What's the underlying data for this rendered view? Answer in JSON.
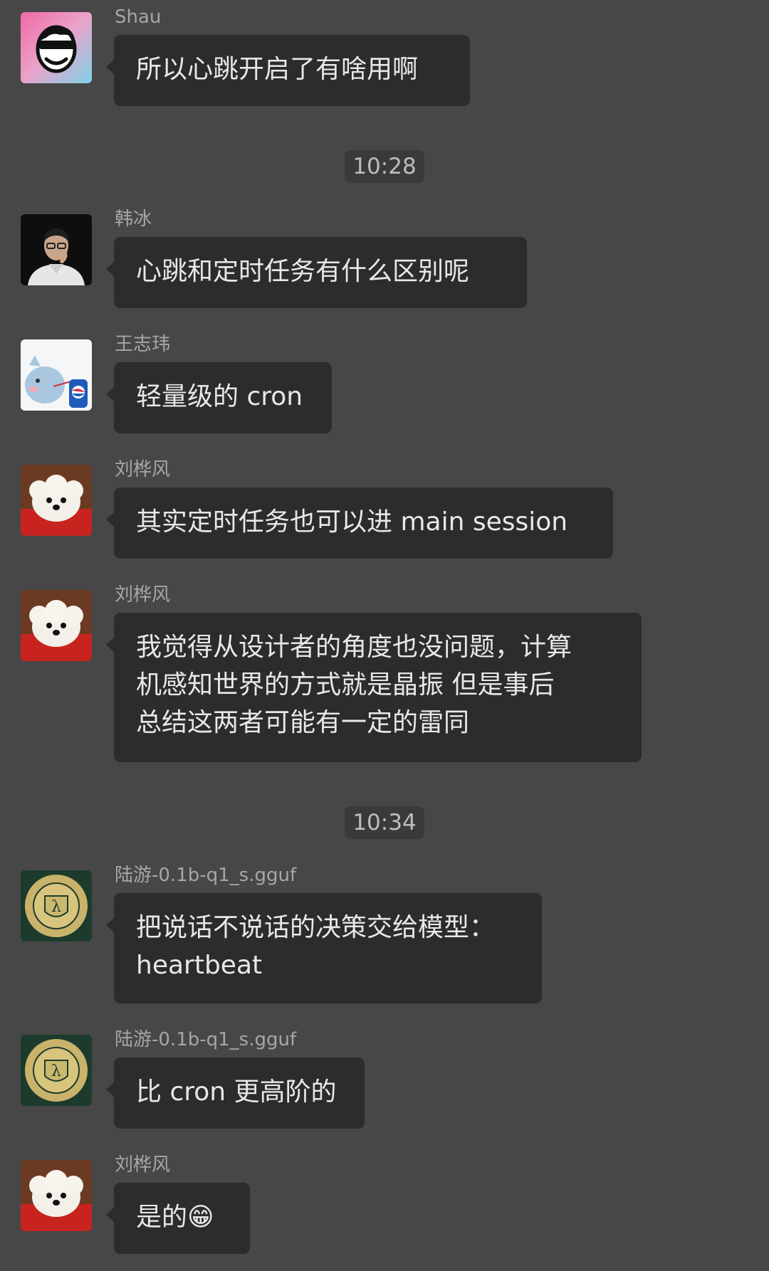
{
  "messages": [
    {
      "sender": "Shau",
      "avatar_icon": "sunglasses-cartoon-avatar-icon",
      "lines": [
        "所以心跳开启了有啥用啊"
      ]
    },
    {
      "sender": "韩冰",
      "avatar_icon": "man-portrait-avatar-icon",
      "lines": [
        "心跳和定时任务有什么区别呢"
      ]
    },
    {
      "sender": "王志玮",
      "avatar_icon": "cartoon-pig-pepsi-avatar-icon",
      "lines": [
        "轻量级的 cron"
      ]
    },
    {
      "sender": "刘桦风",
      "avatar_icon": "white-poodle-avatar-icon",
      "lines": [
        "其实定时任务也可以进 main session"
      ]
    },
    {
      "sender": "刘桦风",
      "avatar_icon": "white-poodle-avatar-icon",
      "lines": [
        "我觉得从设计者的角度也没问题，计算",
        "机感知世界的方式就是晶振  但是事后",
        "总结这两者可能有一定的雷同"
      ]
    },
    {
      "sender": "陆游-0.1b-q1_s.gguf",
      "avatar_icon": "mit-seal-avatar-icon",
      "lines": [
        "把说话不说话的决策交给模型：",
        "heartbeat"
      ]
    },
    {
      "sender": "陆游-0.1b-q1_s.gguf",
      "avatar_icon": "mit-seal-avatar-icon",
      "lines": [
        "比 cron 更高阶的"
      ]
    },
    {
      "sender": "刘桦风",
      "avatar_icon": "white-poodle-avatar-icon",
      "lines": [
        "是的😁"
      ]
    }
  ],
  "timestamps": [
    "10:28",
    "10:34"
  ],
  "colors": {
    "background": "#474747",
    "bubble": "#2c2c2c",
    "bubble_text": "#e8e8e8",
    "sender_text": "#a6a6a6",
    "timestamp_bg": "#3a3a3a"
  }
}
